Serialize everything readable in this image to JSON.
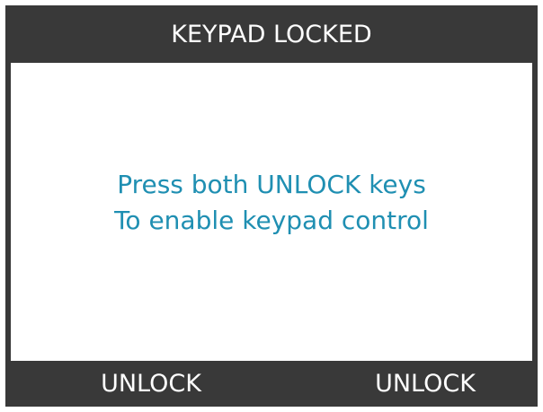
{
  "header": {
    "title": "KEYPAD LOCKED"
  },
  "message": {
    "line1": "Press both UNLOCK keys",
    "line2": "To enable keypad control"
  },
  "softkeys": {
    "left": "UNLOCK",
    "right": "UNLOCK"
  },
  "colors": {
    "frame": "#393939",
    "message_text": "#1f8fb2",
    "header_text": "#ffffff"
  }
}
